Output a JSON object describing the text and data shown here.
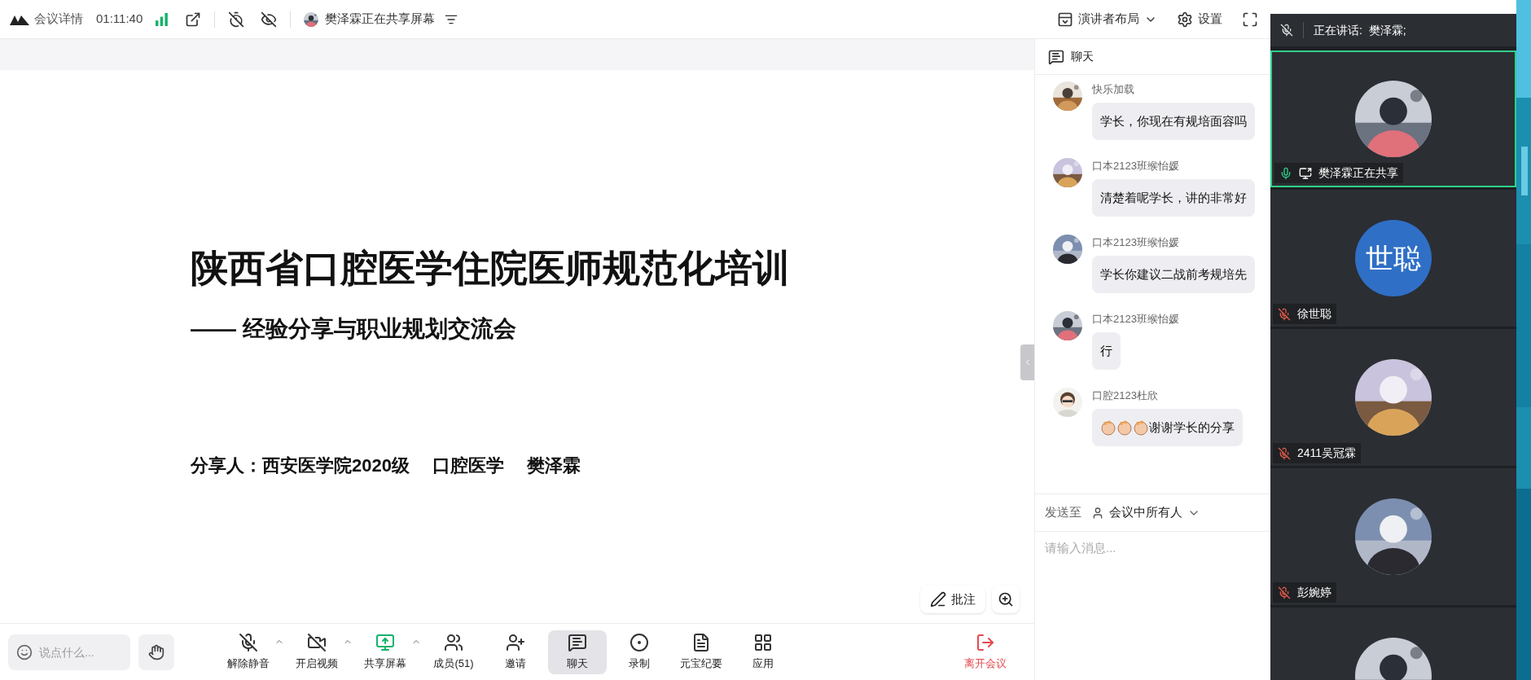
{
  "top_bar": {
    "meeting_info": "会议详情",
    "duration": "01:11:40",
    "sharing_status": "樊泽霖正在共享屏幕",
    "layout": "演讲者布局",
    "settings": "设置"
  },
  "slide": {
    "title": "陕西省口腔医学住院医师规范化培训",
    "subtitle": "—— 经验分享与职业规划交流会",
    "presenter": [
      "分享人：西安医学院2020级",
      "口腔医学",
      "樊泽霖"
    ]
  },
  "annotation": {
    "label": "批注"
  },
  "chat": {
    "title": "聊天",
    "messages": [
      {
        "kind": "text",
        "sender": "快乐加载",
        "text": "学长，你现在有规培面容吗"
      },
      {
        "kind": "text",
        "sender": "口本2123班缑怡媛",
        "text": "清楚着呢学长，讲的非常好"
      },
      {
        "kind": "text",
        "sender": "口本2123班缑怡媛",
        "text": "学长你建议二战前考规培先"
      },
      {
        "kind": "text",
        "sender": "口本2123班缑怡媛",
        "text": "行"
      },
      {
        "kind": "clap",
        "sender": "口腔2123杜欣",
        "text": "谢谢学长的分享"
      }
    ],
    "send_to_label": "发送至",
    "recipient": "会议中所有人",
    "placeholder": "请输入消息..."
  },
  "speaker_bar": {
    "text": "正在讲话:  樊泽霖;"
  },
  "participants": [
    {
      "name": "樊泽霖正在共享",
      "muted": false,
      "speaking": true,
      "sharing": true
    },
    {
      "name": "徐世聪",
      "muted": true,
      "speaking": false,
      "sharing": false,
      "avatar": {
        "kind": "initials",
        "text": "世聪"
      }
    },
    {
      "name": "2411吴冠霖",
      "muted": true,
      "speaking": false,
      "sharing": false
    },
    {
      "name": "彭婉婷",
      "muted": true,
      "speaking": false,
      "sharing": false
    },
    {
      "speaking": false
    }
  ],
  "bottom_bar": {
    "reaction_placeholder": "说点什么...",
    "controls": [
      {
        "kind": "mic",
        "label": "解除静音",
        "menu": true,
        "selected": false
      },
      {
        "kind": "video",
        "label": "开启视频",
        "menu": true,
        "selected": false
      },
      {
        "kind": "share",
        "label": "共享屏幕",
        "menu": true,
        "selected": false
      },
      {
        "kind": "members",
        "label": "成员(51)",
        "menu": false,
        "selected": false
      },
      {
        "kind": "invite",
        "label": "邀请",
        "menu": false,
        "selected": false
      },
      {
        "kind": "chat",
        "label": "聊天",
        "menu": false,
        "selected": true
      },
      {
        "kind": "record",
        "label": "录制",
        "menu": false,
        "selected": false
      },
      {
        "kind": "summary",
        "label": "元宝纪要",
        "menu": false,
        "selected": false
      },
      {
        "kind": "apps",
        "label": "应用",
        "menu": false,
        "selected": false
      }
    ],
    "leave": "离开会议"
  }
}
